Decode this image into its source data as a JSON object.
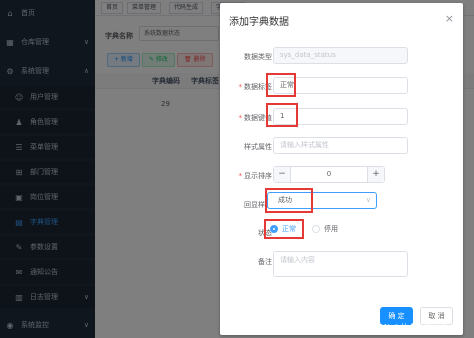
{
  "sidebar": {
    "items": [
      {
        "label": "首页",
        "icon": "home-icon",
        "glyph": "⌂"
      },
      {
        "label": "仓库管理",
        "icon": "warehouse-icon",
        "glyph": "▦"
      },
      {
        "label": "系统管理",
        "icon": "gear-icon",
        "glyph": "⚙"
      },
      {
        "label": "用户管理",
        "icon": "user-icon",
        "glyph": "☺"
      },
      {
        "label": "角色管理",
        "icon": "role-icon",
        "glyph": "♟"
      },
      {
        "label": "菜单管理",
        "icon": "menu-icon",
        "glyph": "☰"
      },
      {
        "label": "部门管理",
        "icon": "tree-icon",
        "glyph": "⊞"
      },
      {
        "label": "岗位管理",
        "icon": "post-icon",
        "glyph": "▣"
      },
      {
        "label": "字典管理",
        "icon": "dict-icon",
        "glyph": "▤"
      },
      {
        "label": "参数设置",
        "icon": "edit-icon",
        "glyph": "✎"
      },
      {
        "label": "通知公告",
        "icon": "message-icon",
        "glyph": "✉"
      },
      {
        "label": "日志管理",
        "icon": "log-icon",
        "glyph": "▥"
      },
      {
        "label": "系统监控",
        "icon": "monitor-icon",
        "glyph": "◉"
      }
    ],
    "expand_arrow": "∨",
    "collapse_arrow": "∧"
  },
  "tabs": [
    "首页",
    "菜单管理",
    "代码生成",
    "字典数据"
  ],
  "filter": {
    "label": "字典名称",
    "value": "系统数据状态"
  },
  "toolbar": {
    "add": "+ 新增",
    "edit": "✎ 修改",
    "delete": "🗑 删除"
  },
  "table": {
    "headers": [
      "",
      "字典编码",
      "字典标签"
    ],
    "row": {
      "code": "29"
    }
  },
  "dialog": {
    "title": "添加字典数据",
    "close": "×",
    "dict_type_label": "数据类型",
    "dict_type_value": "sys_data_status",
    "dict_label_label": "数据标签",
    "dict_label_value": "正常",
    "dict_value_label": "数据键值",
    "dict_value_value": "1",
    "css_class_label": "样式属性",
    "css_class_placeholder": "请输入样式属性",
    "sort_label": "显示排序",
    "sort_value": "0",
    "sort_minus": "−",
    "sort_plus": "+",
    "list_class_label": "回显样式",
    "list_class_value": "成功",
    "status_label": "状态",
    "status_options": [
      "正常",
      "停用"
    ],
    "remark_label": "备注",
    "remark_placeholder": "请输入内容",
    "confirm": "确 定",
    "cancel": "取 消",
    "required_mark": "*"
  },
  "watermark": "CSDN @什么小熊饼干",
  "colors": {
    "primary": "#1890ff",
    "highlight": "#e53935",
    "sidebar_bg": "#1f2d3d"
  }
}
